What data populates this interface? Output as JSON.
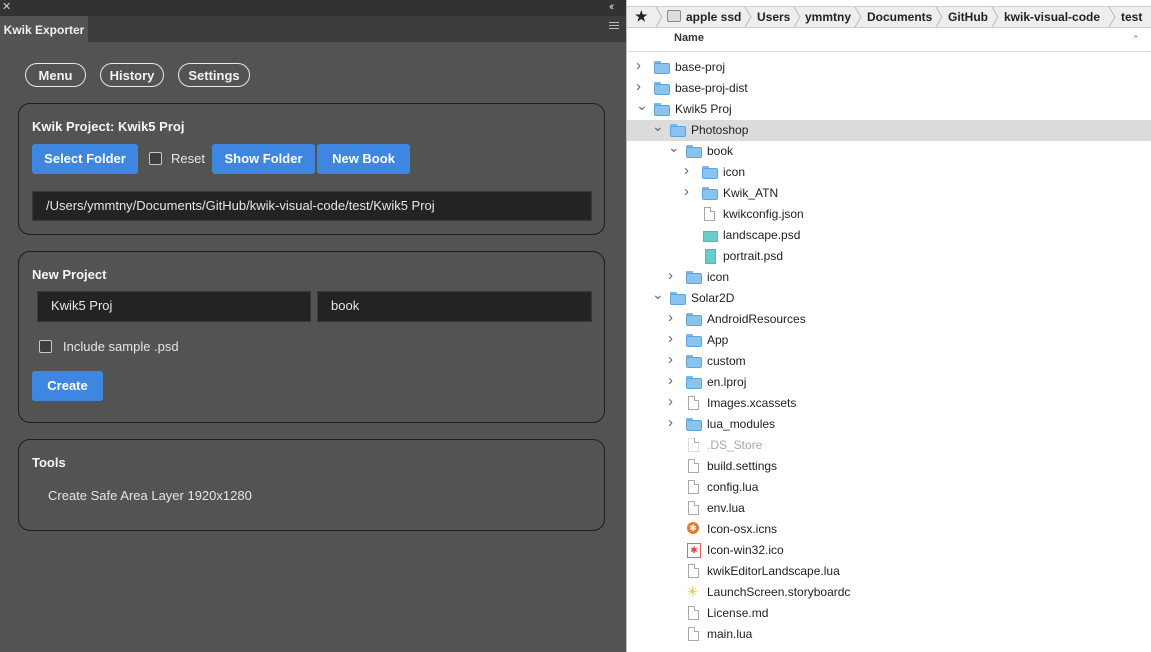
{
  "left_panel": {
    "tab_label": "Kwik Exporter",
    "nav": {
      "menu": "Menu",
      "history": "History",
      "settings": "Settings"
    },
    "kwik_project": {
      "title": "Kwik Project: Kwik5 Proj",
      "select_folder": "Select Folder",
      "reset_label": "Reset",
      "show_folder": "Show Folder",
      "new_book": "New Book",
      "path_value": "/Users/ymmtny/Documents/GitHub/kwik-visual-code/test/Kwik5 Proj"
    },
    "new_project": {
      "title": "New Project",
      "project_name_value": "Kwik5 Proj",
      "book_name_value": "book",
      "include_sample_label": "Include sample .psd",
      "create": "Create"
    },
    "tools": {
      "title": "Tools",
      "safe_area": "Create Safe Area Layer 1920x1280"
    }
  },
  "right_panel": {
    "breadcrumb": [
      "apple ssd",
      "Users",
      "ymmtny",
      "Documents",
      "GitHub",
      "kwik-visual-code",
      "test"
    ],
    "column_name": "Name",
    "tree": [
      {
        "name": "base-proj",
        "kind": "folder",
        "state": "collapsed"
      },
      {
        "name": "base-proj-dist",
        "kind": "folder",
        "state": "collapsed"
      },
      {
        "name": "Kwik5 Proj",
        "kind": "folder",
        "state": "expanded"
      },
      {
        "name": "Photoshop",
        "kind": "folder",
        "state": "expanded",
        "selected": true
      },
      {
        "name": "book",
        "kind": "folder",
        "state": "expanded"
      },
      {
        "name": "icon",
        "kind": "folder",
        "state": "collapsed"
      },
      {
        "name": "Kwik_ATN",
        "kind": "folder",
        "state": "collapsed"
      },
      {
        "name": "kwikconfig.json",
        "kind": "file"
      },
      {
        "name": "landscape.psd",
        "kind": "psd-landscape"
      },
      {
        "name": "portrait.psd",
        "kind": "psd-portrait"
      },
      {
        "name": "icon",
        "kind": "folder",
        "state": "collapsed"
      },
      {
        "name": "Solar2D",
        "kind": "folder",
        "state": "expanded"
      },
      {
        "name": "AndroidResources",
        "kind": "folder",
        "state": "collapsed"
      },
      {
        "name": "App",
        "kind": "folder",
        "state": "collapsed"
      },
      {
        "name": "custom",
        "kind": "folder",
        "state": "collapsed"
      },
      {
        "name": "en.lproj",
        "kind": "folder",
        "state": "collapsed"
      },
      {
        "name": "Images.xcassets",
        "kind": "file",
        "state": "collapsed"
      },
      {
        "name": "lua_modules",
        "kind": "folder",
        "state": "collapsed"
      },
      {
        "name": ".DS_Store",
        "kind": "file-dim"
      },
      {
        "name": "build.settings",
        "kind": "file"
      },
      {
        "name": "config.lua",
        "kind": "file"
      },
      {
        "name": "env.lua",
        "kind": "file"
      },
      {
        "name": "Icon-osx.icns",
        "kind": "icns"
      },
      {
        "name": "Icon-win32.ico",
        "kind": "ico"
      },
      {
        "name": "kwikEditorLandscape.lua",
        "kind": "file"
      },
      {
        "name": "LaunchScreen.storyboardc",
        "kind": "storyboard"
      },
      {
        "name": "License.md",
        "kind": "file"
      },
      {
        "name": "main.lua",
        "kind": "file"
      }
    ]
  }
}
